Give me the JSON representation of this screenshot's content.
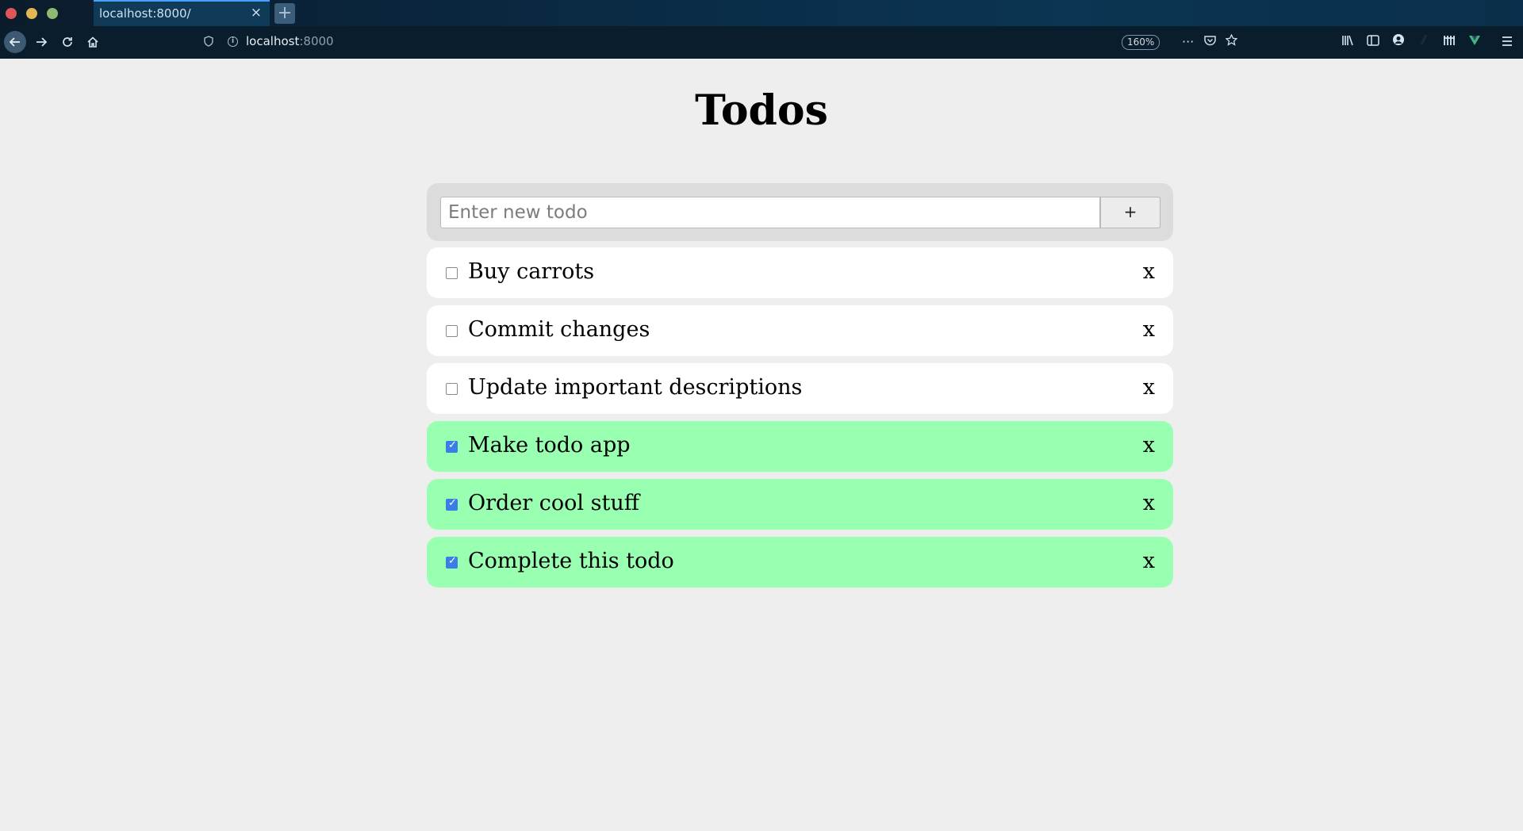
{
  "browser": {
    "tab_title": "localhost:8000/",
    "tab_close": "×",
    "new_tab": "+",
    "url_host": "localhost",
    "url_port": ":8000",
    "zoom": "160%",
    "more_actions": "···"
  },
  "page": {
    "title": "Todos",
    "input_placeholder": "Enter new todo",
    "add_label": "+",
    "delete_label": "x"
  },
  "todos": [
    {
      "text": "Buy carrots",
      "done": false
    },
    {
      "text": "Commit changes",
      "done": false
    },
    {
      "text": "Update important descriptions",
      "done": false
    },
    {
      "text": "Make todo app",
      "done": true
    },
    {
      "text": "Order cool stuff",
      "done": true
    },
    {
      "text": "Complete this todo",
      "done": true
    }
  ],
  "colors": {
    "done_bg": "#99ffb1",
    "open_bg": "#ffffff",
    "check_accent": "#3a7ee8"
  }
}
